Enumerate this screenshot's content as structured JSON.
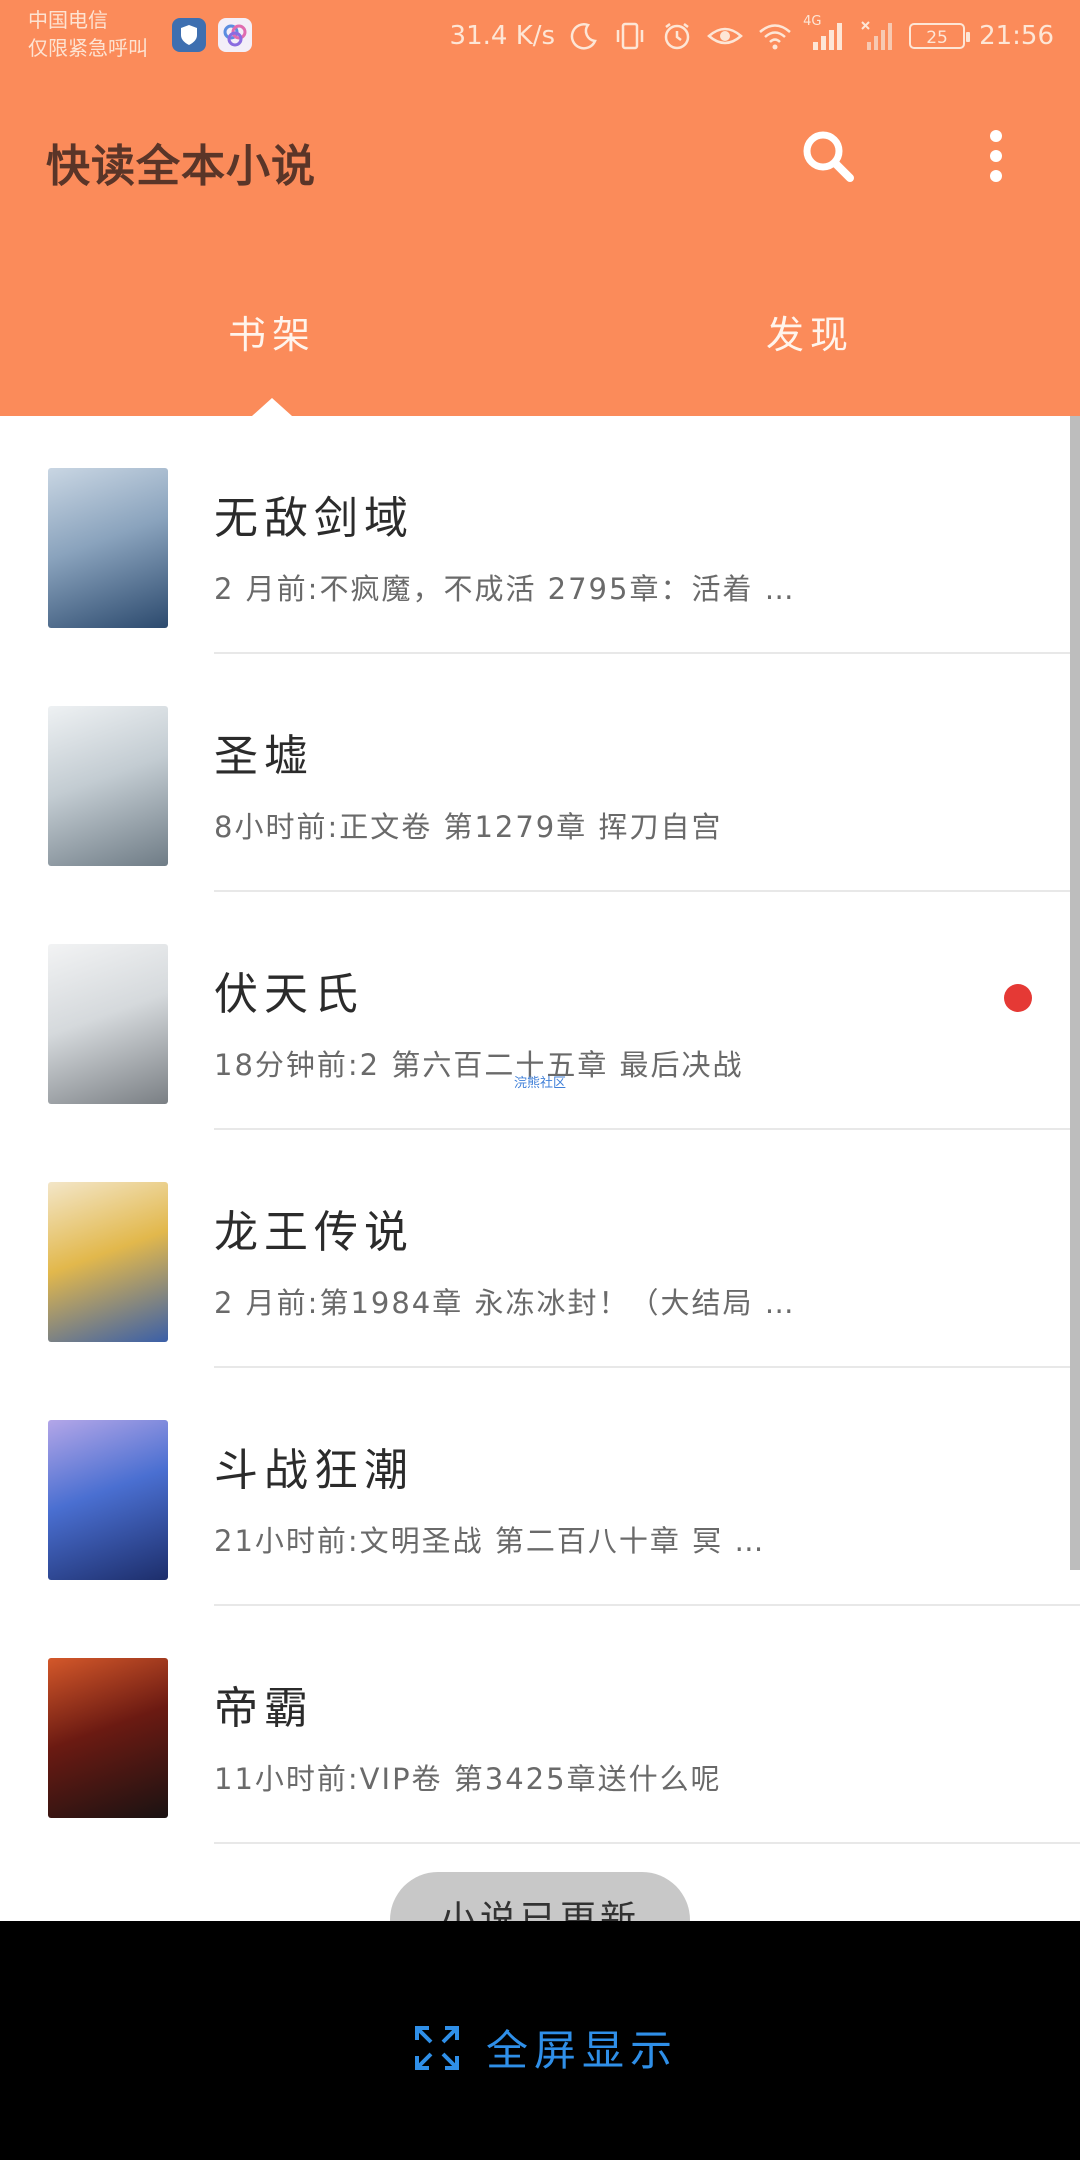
{
  "status_bar": {
    "carrier_line1": "中国电信",
    "carrier_line2": "仅限紧急呼叫",
    "network_speed": "31.4 K/s",
    "network_type": "4G",
    "battery": "25",
    "time": "21:56"
  },
  "app_bar": {
    "title": "快读全本小说",
    "search_icon": "search-icon",
    "more_icon": "more-vert-icon"
  },
  "tabs": [
    {
      "label": "书架",
      "selected": true
    },
    {
      "label": "发现",
      "selected": false
    }
  ],
  "books": [
    {
      "title": "无敌剑域",
      "meta": "2 月前:不疯魔，不成活 2795章：活着 …",
      "has_update": false,
      "cover_colors": [
        "#2c4a6e",
        "#8aa3bd",
        "#c9d6e3"
      ]
    },
    {
      "title": "圣墟",
      "meta": "8小时前:正文卷 第1279章 挥刀自宫",
      "has_update": false,
      "cover_colors": [
        "#6f7c86",
        "#c3ccd2",
        "#eef1f3"
      ]
    },
    {
      "title": "伏天氏",
      "meta": "18分钟前:2 第六百二十五章 最后决战",
      "has_update": true,
      "cover_colors": [
        "#7a7f84",
        "#d5d9dc",
        "#f2f3f4"
      ]
    },
    {
      "title": "龙王传说",
      "meta": "2 月前:第1984章 永冻冰封！（大结局 …",
      "has_update": false,
      "cover_colors": [
        "#3a5fa8",
        "#e2b84c",
        "#f3e6c8"
      ]
    },
    {
      "title": "斗战狂潮",
      "meta": "21小时前:文明圣战 第二百八十章 冥 …",
      "has_update": false,
      "cover_colors": [
        "#1d2e6b",
        "#4a6fd1",
        "#b3a6e8"
      ]
    },
    {
      "title": "帝霸",
      "meta": "11小时前:VIP卷 第3425章送什么呢",
      "has_update": false,
      "cover_colors": [
        "#1a1212",
        "#6b1a12",
        "#d4582a"
      ]
    }
  ],
  "watermark": "浣熊社区",
  "toast": "小说已更新",
  "nav_bar": {
    "fullscreen_label": "全屏显示",
    "fullscreen_icon": "expand-icon"
  },
  "colors": {
    "accent": "#fb8b5a",
    "title_text": "#5a3528",
    "update_dot": "#e53935",
    "fullscreen_blue": "#2f8fe8"
  }
}
